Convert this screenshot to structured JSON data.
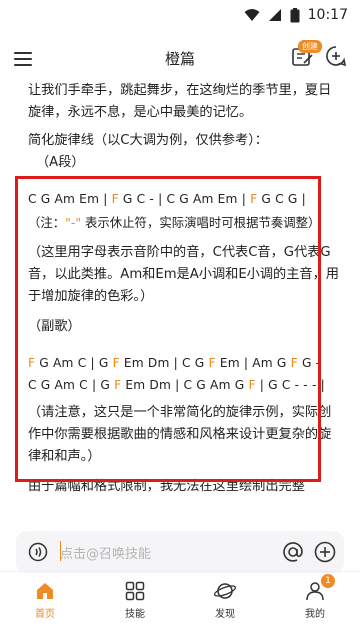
{
  "status_bar": {
    "time": "10:17"
  },
  "header": {
    "title": "橙篇",
    "create_badge": "创建"
  },
  "content": {
    "intro": "让我们手牵手，跳起舞步，在这绚烂的季节里，夏日旋律，永远不息，是心中最美的记忆。",
    "simplified_title": "简化旋律线（以C大调为例，仅供参考）：",
    "section_a": "（A段）",
    "section_a_line": [
      "C G Am Em | ",
      "F",
      " G C - | C G Am Em | ",
      "F",
      " G C G |"
    ],
    "note_prefix": "（注：",
    "note_dash": "\"-\"",
    "note_suffix": " 表示休止符，实际演唱时可根据节奏调整）",
    "explain": "（这里用字母表示音阶中的音，C代表C音，G代表G音，以此类推。Am和Em是A小调和E小调的主音，用于增加旋律的色彩。）",
    "chorus_label": "（副歌）",
    "chorus_line1": [
      "F",
      " G Am C | G ",
      "F",
      " Em Dm | C G ",
      "F",
      " Em | Am G ",
      "F",
      " G -"
    ],
    "chorus_line2": [
      "C G Am C | G ",
      "F",
      " Em Dm | C G Am G ",
      "F",
      " | G C - - - |"
    ],
    "disclaimer": "（请注意，这只是一个非常简化的旋律示例，实际创作中你需要根据歌曲的情感和风格来设计更复杂的旋律和和声。）",
    "tail": "由于篇幅和格式限制，我无法在这里绘制出完整"
  },
  "input": {
    "placeholder": "点击@召唤技能"
  },
  "nav": {
    "items": [
      {
        "label": "首页"
      },
      {
        "label": "技能"
      },
      {
        "label": "发现"
      },
      {
        "label": "我的",
        "badge": "1"
      }
    ]
  },
  "colors": {
    "accent": "#F08A24",
    "highlight_box": "#E01B1B"
  }
}
